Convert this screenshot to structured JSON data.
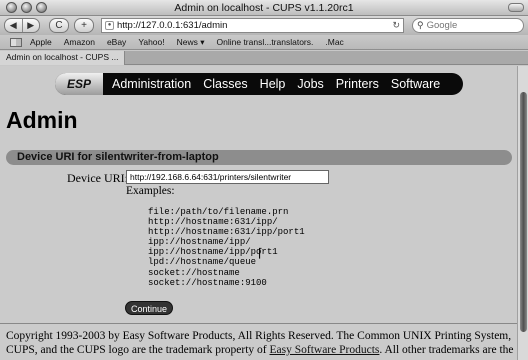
{
  "window": {
    "title": "Admin on localhost - CUPS v1.1.20rc1"
  },
  "toolbar": {
    "back_icon": "back-arrow-icon",
    "forward_icon": "forward-arrow-icon",
    "reload_label": "C",
    "add_label": "+",
    "url": "http://127.0.0.1:631/admin",
    "search_placeholder": "Google"
  },
  "bookmarks": [
    "Apple",
    "Amazon",
    "eBay",
    "Yahoo!",
    "News ▾",
    "Online transl...translators.",
    ".Mac"
  ],
  "tabs": [
    {
      "label": "Admin on localhost - CUPS ..."
    }
  ],
  "nav": {
    "esp": "ESP",
    "links": [
      "Administration",
      "Classes",
      "Help",
      "Jobs",
      "Printers",
      "Software"
    ]
  },
  "page": {
    "title": "Admin",
    "section": "Device URI for silentwriter-from-laptop",
    "uri_label": "Device URI:",
    "uri_value": "http://192.168.6.64:631/printers/silentwriter",
    "examples_label": "Examples:",
    "examples": [
      "file:/path/to/filename.prn",
      "http://hostname:631/ipp/",
      "http://hostname:631/ipp/port1",
      "ipp://hostname/ipp/",
      "ipp://hostname/ipp/port1",
      "lpd://hostname/queue",
      "socket://hostname",
      "socket://hostname:9100"
    ],
    "continue_label": "Continue"
  },
  "footer": {
    "line1": "Copyright 1993-2003 by Easy Software Products, All Rights Reserved. The Common UNIX Printing System,",
    "line2_pre": "CUPS, and the CUPS logo are the trademark property of ",
    "line2_link": "Easy Software Products",
    "line2_post": ". All other trademarks are the"
  }
}
